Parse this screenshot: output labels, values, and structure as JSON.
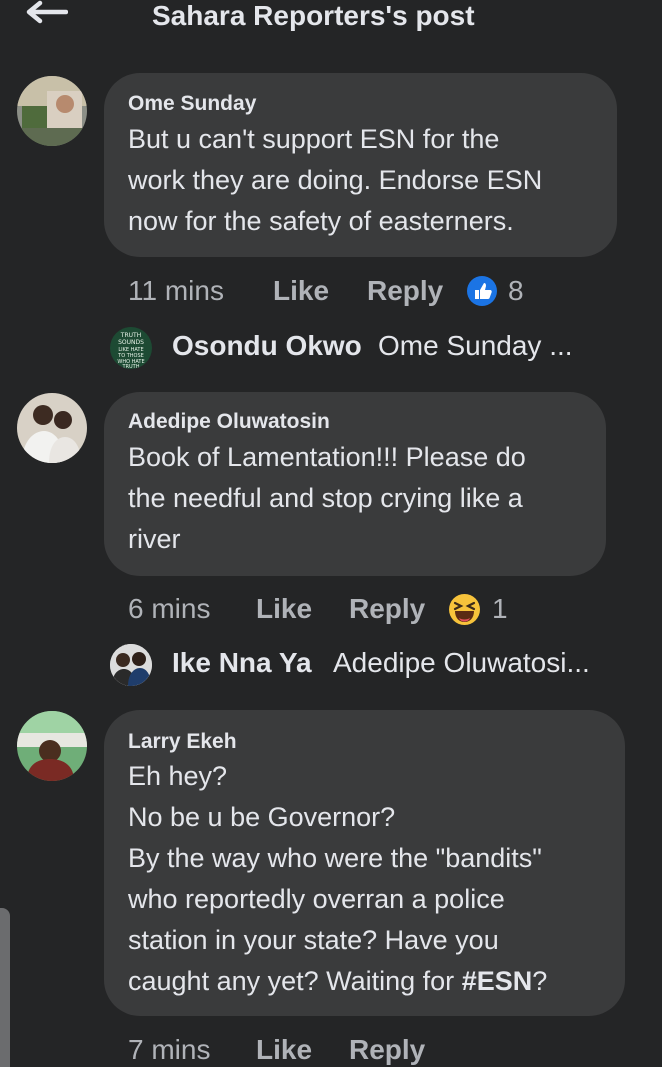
{
  "header": {
    "title": "Sahara Reporters's post",
    "back_icon": "arrow-left-icon"
  },
  "comments": [
    {
      "author": "Ome Sunday",
      "text": "But u can't support ESN for the\nwork they are doing. Endorse ESN\nnow for the safety of easterners.",
      "time": "11 mins",
      "like_label": "Like",
      "reply_label": "Reply",
      "reaction_icon": "like-icon",
      "reaction_count": "8",
      "reply": {
        "name": "Osondu Okwo",
        "preview": "Ome Sunday ...",
        "avatar_text": "TRUTH SOUNDS LIKE HATE TO THOSE WHO HATE TRUTH"
      }
    },
    {
      "author": "Adedipe Oluwatosin",
      "text": "Book of Lamentation!!! Please do\nthe needful and stop crying like a\nriver",
      "time": "6 mins",
      "like_label": "Like",
      "reply_label": "Reply",
      "reaction_icon": "haha-icon",
      "reaction_count": "1",
      "reply": {
        "name": "Ike Nna Ya",
        "preview": "Adedipe Oluwatosi..."
      }
    },
    {
      "author": "Larry Ekeh",
      "text_lines": [
        "Eh hey?",
        "No be u be Governor?",
        "By the way who were the \"bandits\"",
        "who reportedly overran a police",
        "station in your state? Have you",
        "caught any yet? Waiting for "
      ],
      "hashtag": "#ESN",
      "end_punct": "?",
      "time": "7 mins",
      "like_label": "Like",
      "reply_label": "Reply"
    }
  ],
  "colors": {
    "background": "#242526",
    "bubble": "#3a3b3c",
    "text": "#e4e6eb",
    "meta": "#b0b3b8",
    "like_blue": "#1b74e4"
  }
}
